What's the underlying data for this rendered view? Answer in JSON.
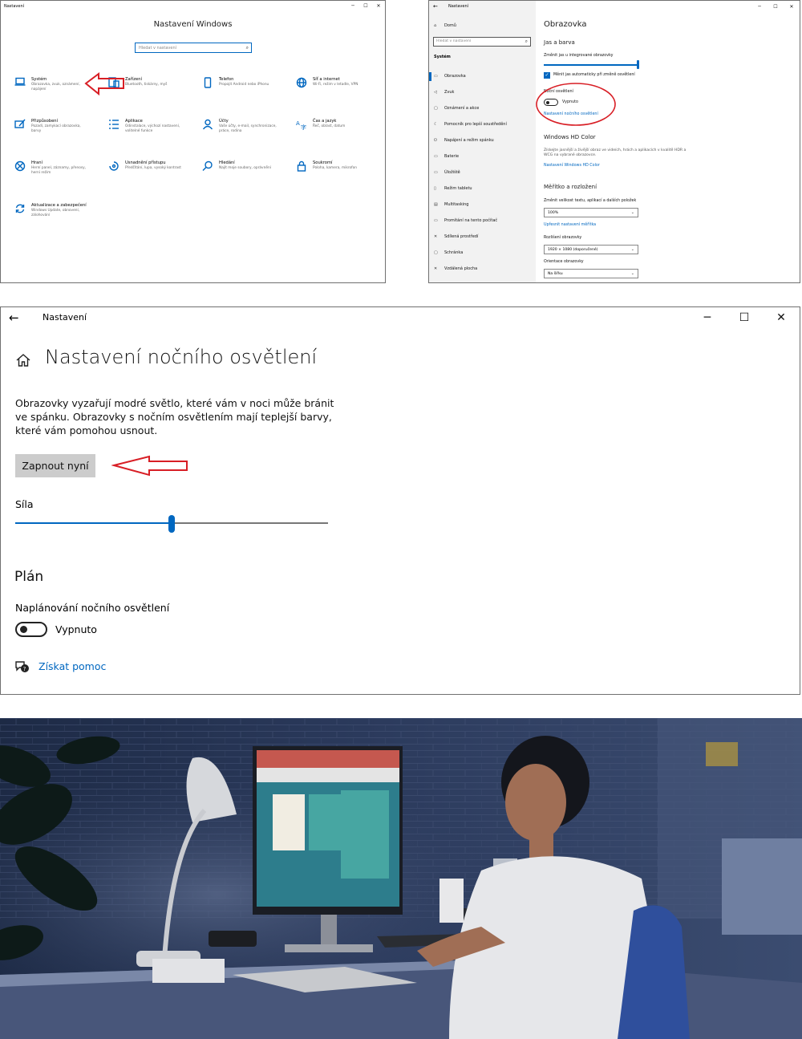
{
  "window1": {
    "app_title": "Nastavení",
    "heading": "Nastavení Windows",
    "search_placeholder": "Hledat v nastavení",
    "categories": [
      {
        "title": "Systém",
        "desc": "Obrazovka, zvuk, oznámení, napájení"
      },
      {
        "title": "Zařízení",
        "desc": "Bluetooth, tiskárny, myš"
      },
      {
        "title": "Telefon",
        "desc": "Propojit Android nebo iPhonu"
      },
      {
        "title": "Síť a internet",
        "desc": "Wi-Fi, režim v letadle, VPN"
      },
      {
        "title": "Přizpůsobení",
        "desc": "Pozadí, zamykací obrazovka, barvy"
      },
      {
        "title": "Aplikace",
        "desc": "Odinstalace, výchozí nastavení, volitelné funkce"
      },
      {
        "title": "Účty",
        "desc": "Vaše účty, e-mail, synchronizace, práce, rodina"
      },
      {
        "title": "Čas a jazyk",
        "desc": "Řeč, oblast, datum"
      },
      {
        "title": "Hraní",
        "desc": "Herní panel, záznamy, přenosy, herní režim"
      },
      {
        "title": "Usnadnění přístupu",
        "desc": "Předčítání, lupa, vysoký kontrast"
      },
      {
        "title": "Hledání",
        "desc": "Najít moje soubory, oprávnění"
      },
      {
        "title": "Soukromí",
        "desc": "Poloha, kamera, mikrofon"
      },
      {
        "title": "Aktualizace a zabezpečení",
        "desc": "Windows Update, obnovení, zálohování"
      }
    ]
  },
  "window2": {
    "app_title": "Nastavení",
    "home": "Domů",
    "search_placeholder": "Hledat v nastavení",
    "section": "Systém",
    "sidebar": [
      "Obrazovka",
      "Zvuk",
      "Oznámení a akce",
      "Pomocník pro lepší soustředění",
      "Napájení a režim spánku",
      "Baterie",
      "Úložiště",
      "Režim tabletu",
      "Multitasking",
      "Promítání na tento počítač",
      "Sdílená prostředí",
      "Schránka",
      "Vzdálená plocha"
    ],
    "title": "Obrazovka",
    "jas_heading": "Jas a barva",
    "brightness_label": "Změnit jas u integrované obrazovky",
    "brightness_level": 1.0,
    "auto_checkbox": "Měnit jas automaticky při změně osvětlení",
    "night_label": "Noční osvětlení",
    "night_state": "Vypnuto",
    "night_link": "Nastavení nočního osvětlení",
    "hd_heading": "Windows HD Color",
    "hd_desc": "Získejte jasnější a živější obraz ve videích, hrách a aplikacích v kvalitě HDR a WCG na vybrané obrazovce.",
    "hd_link": "Nastavení Windows HD Color",
    "scale_heading": "Měřítko a rozložení",
    "scale_label": "Změnit velikost textu, aplikací a dalších položek",
    "scale_value": "100%",
    "scale_link": "Upřesnit nastavení měřítka",
    "res_label": "Rozlišení obrazovky",
    "res_value": "1920 × 1080 (doporučené)",
    "orient_label": "Orientace obrazovky",
    "orient_value": "Na šířku"
  },
  "window3": {
    "app_title": "Nastavení",
    "title": "Nastavení nočního osvětlení",
    "description": "Obrazovky vyzařují modré světlo, které vám v noci může bránit ve spánku. Obrazovky s nočním osvětlením mají teplejší barvy, které vám pomohou usnout.",
    "button": "Zapnout nyní",
    "strength_label": "Síla",
    "strength_level": 0.5,
    "plan_heading": "Plán",
    "schedule_label": "Naplánování nočního osvětlení",
    "schedule_state": "Vypnuto",
    "help_link": "Získat pomoc"
  },
  "colors": {
    "accent": "#0067c0",
    "annotation": "#d81e25"
  }
}
